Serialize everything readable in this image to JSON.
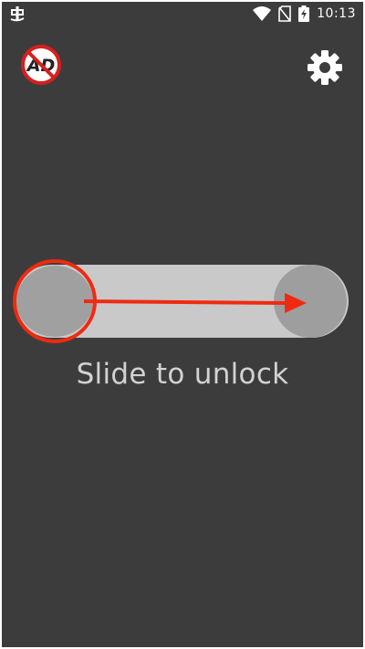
{
  "status_bar": {
    "time": "10:13",
    "icons": [
      "bug-icon",
      "wifi-icon",
      "no-sim-icon",
      "battery-charging-icon"
    ]
  },
  "toolbar": {
    "left_icon": "no-ads-icon",
    "left_icon_text": "AD",
    "right_icon": "settings-gear-icon"
  },
  "unlock": {
    "label": "Slide to unlock",
    "direction": "left-to-right"
  },
  "colors": {
    "background": "#3c3c3c",
    "track": "#c9c9c9",
    "handle": "#a0a0a0",
    "annotation": "#f02a10",
    "label": "#d2d2d2"
  }
}
